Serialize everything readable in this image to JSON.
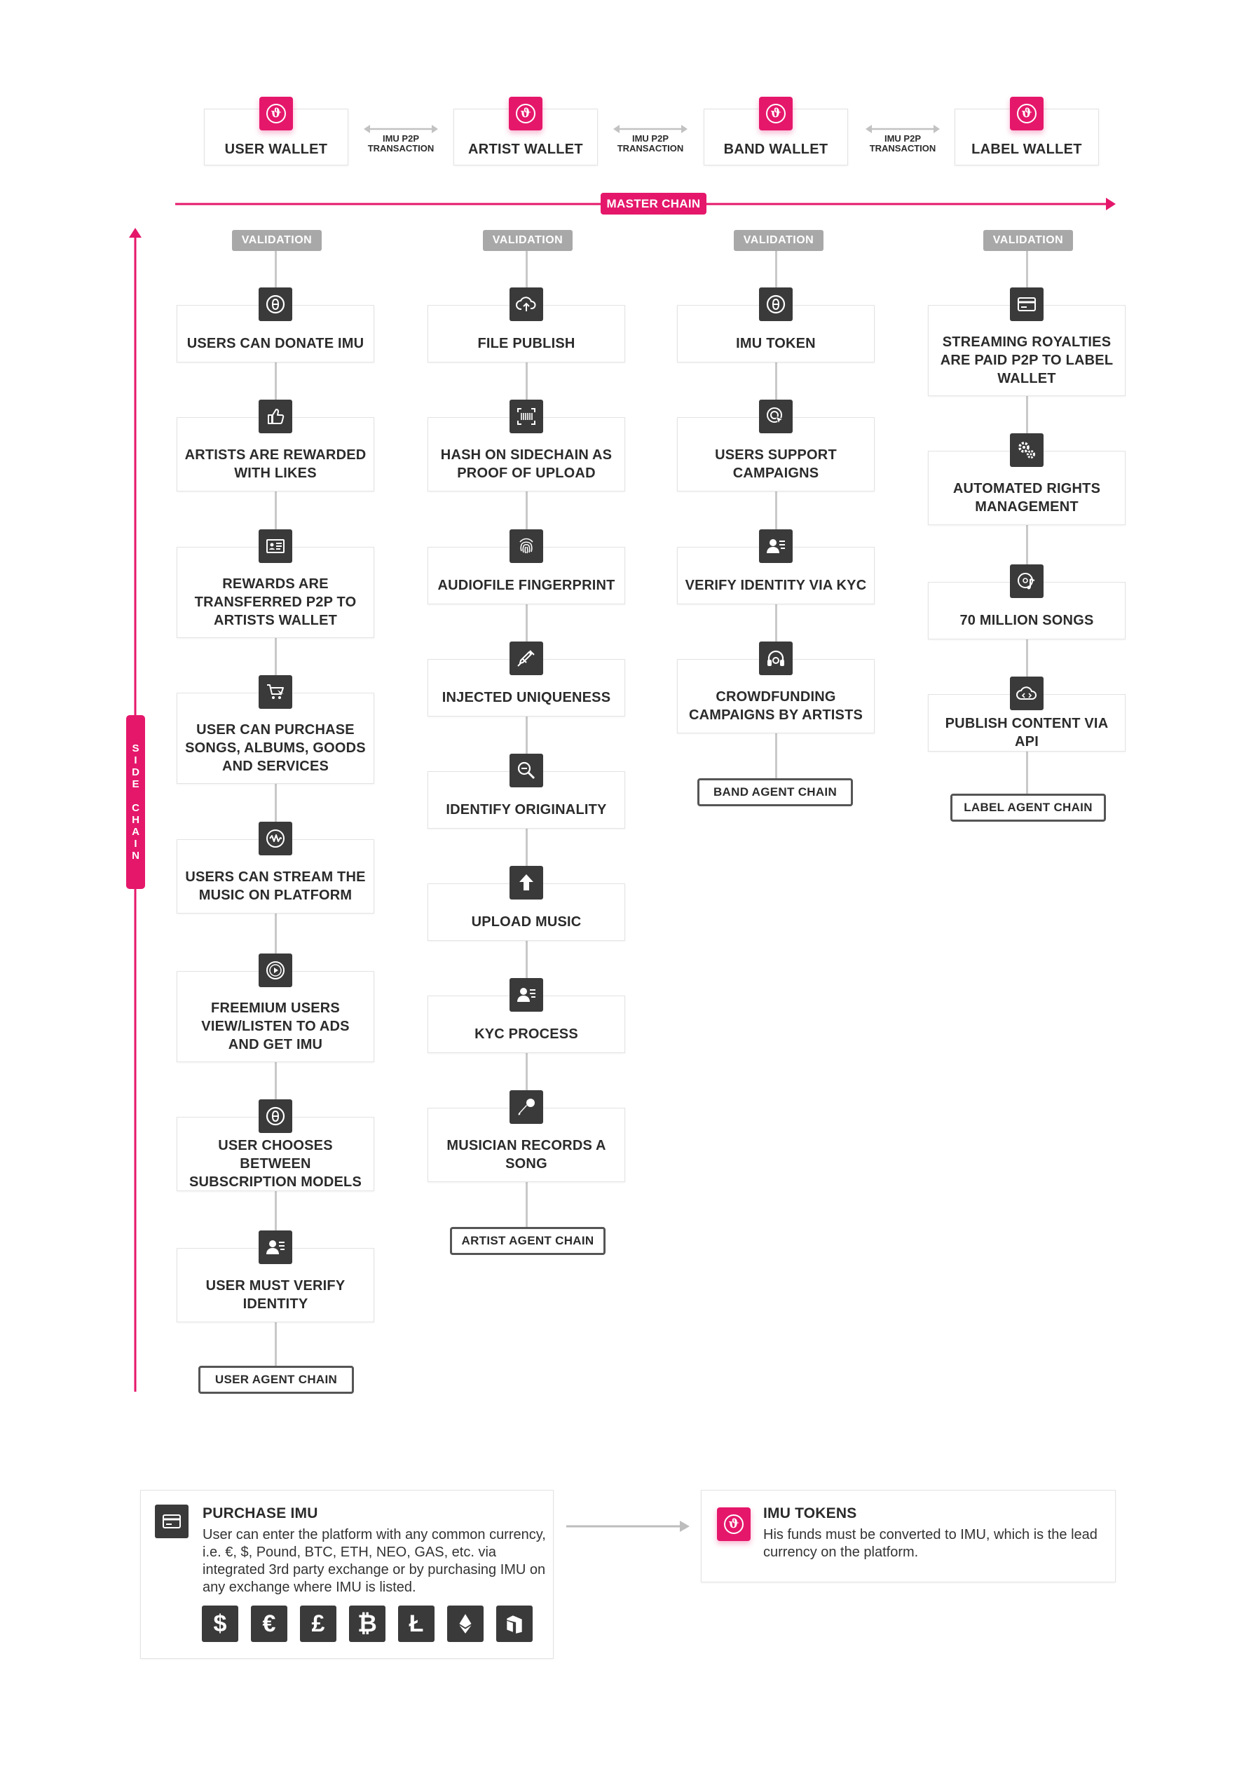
{
  "wallets": [
    {
      "label": "USER WALLET",
      "icon": "imu-logo-icon"
    },
    {
      "label": "ARTIST WALLET",
      "icon": "imu-logo-icon"
    },
    {
      "label": "BAND WALLET",
      "icon": "imu-logo-icon"
    },
    {
      "label": "LABEL WALLET",
      "icon": "imu-logo-icon"
    }
  ],
  "p2p": [
    {
      "line1": "IMU P2P",
      "line2": "TRANSACTION"
    },
    {
      "line1": "IMU P2P",
      "line2": "TRANSACTION"
    },
    {
      "line1": "IMU P2P",
      "line2": "TRANSACTION"
    }
  ],
  "master_chain": "MASTER CHAIN",
  "side_chain": "SIDE CHAIN",
  "validation": "VALIDATION",
  "columns": [
    {
      "agent": "USER AGENT CHAIN",
      "cards": [
        {
          "text": "USERS CAN DONATE IMU",
          "icon": "imu-logo-icon"
        },
        {
          "text": "ARTISTS ARE REWARDED WITH LIKES",
          "icon": "thumbs-up-icon"
        },
        {
          "text": "REWARDS ARE TRANSFERRED P2P TO ARTISTS WALLET",
          "icon": "id-card-icon"
        },
        {
          "text": "USER CAN PURCHASE SONGS, ALBUMS, GOODS AND SERVICES",
          "icon": "shopping-cart-icon"
        },
        {
          "text": "USERS CAN STREAM THE MUSIC ON PLATFORM",
          "icon": "waveform-icon"
        },
        {
          "text": "FREEMIUM USERS VIEW/LISTEN TO ADS AND GET IMU",
          "icon": "play-circle-icon"
        },
        {
          "text": "USER CHOOSES BETWEEN SUBSCRIPTION MODELS",
          "icon": "imu-logo-icon"
        },
        {
          "text": "USER MUST VERIFY IDENTITY",
          "icon": "user-card-icon"
        }
      ]
    },
    {
      "agent": "ARTIST AGENT CHAIN",
      "cards": [
        {
          "text": "FILE PUBLISH",
          "icon": "cloud-upload-icon"
        },
        {
          "text": "HASH ON SIDECHAIN AS PROOF OF UPLOAD",
          "icon": "barcode-scan-icon"
        },
        {
          "text": "AUDIOFILE FINGERPRINT",
          "icon": "fingerprint-icon"
        },
        {
          "text": "INJECTED UNIQUENESS",
          "icon": "syringe-icon"
        },
        {
          "text": "IDENTIFY ORIGINALITY",
          "icon": "magnifier-icon"
        },
        {
          "text": "UPLOAD MUSIC",
          "icon": "upload-arrow-icon"
        },
        {
          "text": "KYC PROCESS",
          "icon": "user-card-icon"
        },
        {
          "text": "MUSICIAN RECORDS A SONG",
          "icon": "microphone-icon"
        }
      ]
    },
    {
      "agent": "BAND AGENT CHAIN",
      "cards": [
        {
          "text": "IMU TOKEN",
          "icon": "imu-logo-icon"
        },
        {
          "text": "USERS SUPPORT CAMPAIGNS",
          "icon": "target-pointer-icon"
        },
        {
          "text": "VERIFY IDENTITY VIA KYC",
          "icon": "user-card-icon"
        },
        {
          "text": "CROWDFUNDING CAMPAIGNS BY ARTISTS",
          "icon": "headphones-icon"
        }
      ]
    },
    {
      "agent": "LABEL AGENT CHAIN",
      "cards": [
        {
          "text": "STREAMING ROYALTIES ARE PAID P2P TO LABEL WALLET",
          "icon": "credit-card-icon"
        },
        {
          "text": "AUTOMATED RIGHTS MANAGEMENT",
          "icon": "gears-icon"
        },
        {
          "text": "70 MILLION SONGS",
          "icon": "music-disc-icon"
        },
        {
          "text": "PUBLISH CONTENT VIA API",
          "icon": "cloud-code-icon"
        }
      ]
    }
  ],
  "purchase": {
    "title": "PURCHASE IMU",
    "text": "User can enter the platform with any common currency, i.e. €, $, Pound, BTC, ETH, NEO, GAS, etc. via integrated 3rd party exchange or by purchasing IMU on any exchange where IMU is listed.",
    "icon": "credit-card-icon",
    "currencies": [
      {
        "glyph": "$",
        "name": "dollar-icon"
      },
      {
        "glyph": "€",
        "name": "euro-icon"
      },
      {
        "glyph": "£",
        "name": "pound-icon"
      },
      {
        "glyph": "₿",
        "name": "bitcoin-icon"
      },
      {
        "glyph": "Ł",
        "name": "litecoin-icon"
      },
      {
        "glyph": "",
        "name": "ethereum-icon"
      },
      {
        "glyph": "",
        "name": "neo-icon"
      }
    ]
  },
  "tokens": {
    "title": "IMU TOKENS",
    "text": "His funds must be converted to IMU, which is the lead currency on the platform.",
    "icon": "imu-logo-icon"
  },
  "colors": {
    "accent": "#e5176b",
    "dark_icon": "#3a3a3a",
    "validation": "#a8a8a8",
    "connector": "#c9c9c9"
  }
}
